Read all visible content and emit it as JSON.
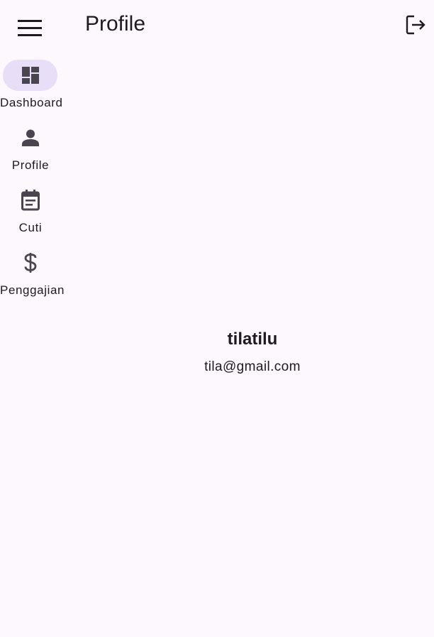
{
  "app_bar": {
    "title": "Profile",
    "menu_icon": "menu-icon",
    "logout_icon": "logout-icon"
  },
  "nav_rail": {
    "items": [
      {
        "label": "Dashboard",
        "icon": "dashboard-icon",
        "selected": true
      },
      {
        "label": "Profile",
        "icon": "person-icon",
        "selected": false
      },
      {
        "label": "Cuti",
        "icon": "calendar-icon",
        "selected": false
      },
      {
        "label": "Penggajian",
        "icon": "dollar-icon",
        "selected": false
      }
    ]
  },
  "profile": {
    "name": "tilatilu",
    "email": "tila@gmail.com"
  },
  "colors": {
    "background": "#fdf7fe",
    "indicator": "#e8def8",
    "icon": "#49454f",
    "text": "#1d1b20"
  }
}
